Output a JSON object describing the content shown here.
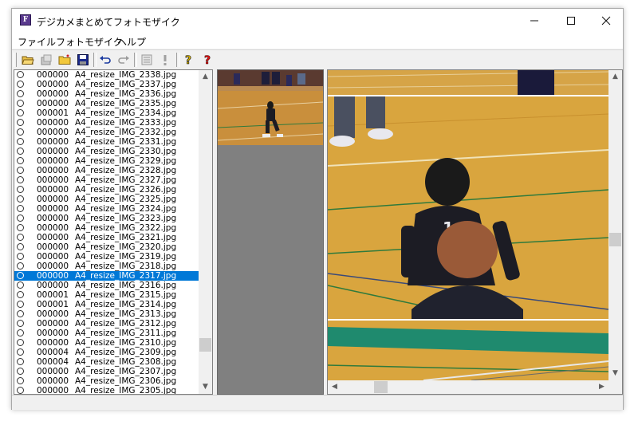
{
  "window": {
    "title": "デジカメまとめてフォトモザイク",
    "icon_letter": "F"
  },
  "menu": [
    "ファイル",
    "フォトモザイク",
    "ヘルプ"
  ],
  "toolbar": {
    "buttons": [
      "open-folder",
      "open-images",
      "new-folder",
      "save",
      "undo",
      "redo",
      "list-view",
      "exclamation",
      "help",
      "context-help"
    ]
  },
  "files": [
    {
      "count": "000000",
      "name": "A4_resize_IMG_2338.jpg"
    },
    {
      "count": "000000",
      "name": "A4_resize_IMG_2337.jpg"
    },
    {
      "count": "000000",
      "name": "A4_resize_IMG_2336.jpg"
    },
    {
      "count": "000000",
      "name": "A4_resize_IMG_2335.jpg"
    },
    {
      "count": "000001",
      "name": "A4_resize_IMG_2334.jpg"
    },
    {
      "count": "000000",
      "name": "A4_resize_IMG_2333.jpg"
    },
    {
      "count": "000000",
      "name": "A4_resize_IMG_2332.jpg"
    },
    {
      "count": "000000",
      "name": "A4_resize_IMG_2331.jpg"
    },
    {
      "count": "000000",
      "name": "A4_resize_IMG_2330.jpg"
    },
    {
      "count": "000000",
      "name": "A4_resize_IMG_2329.jpg"
    },
    {
      "count": "000000",
      "name": "A4_resize_IMG_2328.jpg"
    },
    {
      "count": "000000",
      "name": "A4_resize_IMG_2327.jpg"
    },
    {
      "count": "000000",
      "name": "A4_resize_IMG_2326.jpg"
    },
    {
      "count": "000000",
      "name": "A4_resize_IMG_2325.jpg"
    },
    {
      "count": "000000",
      "name": "A4_resize_IMG_2324.jpg"
    },
    {
      "count": "000000",
      "name": "A4_resize_IMG_2323.jpg"
    },
    {
      "count": "000000",
      "name": "A4_resize_IMG_2322.jpg"
    },
    {
      "count": "000000",
      "name": "A4_resize_IMG_2321.jpg"
    },
    {
      "count": "000000",
      "name": "A4_resize_IMG_2320.jpg"
    },
    {
      "count": "000000",
      "name": "A4_resize_IMG_2319.jpg"
    },
    {
      "count": "000000",
      "name": "A4_resize_IMG_2318.jpg"
    },
    {
      "count": "000000",
      "name": "A4_resize_IMG_2317.jpg"
    },
    {
      "count": "000000",
      "name": "A4_resize_IMG_2316.jpg"
    },
    {
      "count": "000001",
      "name": "A4_resize_IMG_2315.jpg"
    },
    {
      "count": "000001",
      "name": "A4_resize_IMG_2314.jpg"
    },
    {
      "count": "000000",
      "name": "A4_resize_IMG_2313.jpg"
    },
    {
      "count": "000000",
      "name": "A4_resize_IMG_2312.jpg"
    },
    {
      "count": "000000",
      "name": "A4_resize_IMG_2311.jpg"
    },
    {
      "count": "000000",
      "name": "A4_resize_IMG_2310.jpg"
    },
    {
      "count": "000004",
      "name": "A4_resize_IMG_2309.jpg"
    },
    {
      "count": "000004",
      "name": "A4_resize_IMG_2308.jpg"
    },
    {
      "count": "000000",
      "name": "A4_resize_IMG_2307.jpg"
    },
    {
      "count": "000000",
      "name": "A4_resize_IMG_2306.jpg"
    },
    {
      "count": "000000",
      "name": "A4_resize_IMG_2305.jpg"
    }
  ],
  "selected_file": "A4_resize_IMG_2317.jpg",
  "colors": {
    "selection": "#0078d7",
    "floor": "#d9a53e",
    "floor_line_green": "#2f7a3c",
    "court_teal": "#1f8a6e",
    "uniform": "#1c1c24"
  }
}
